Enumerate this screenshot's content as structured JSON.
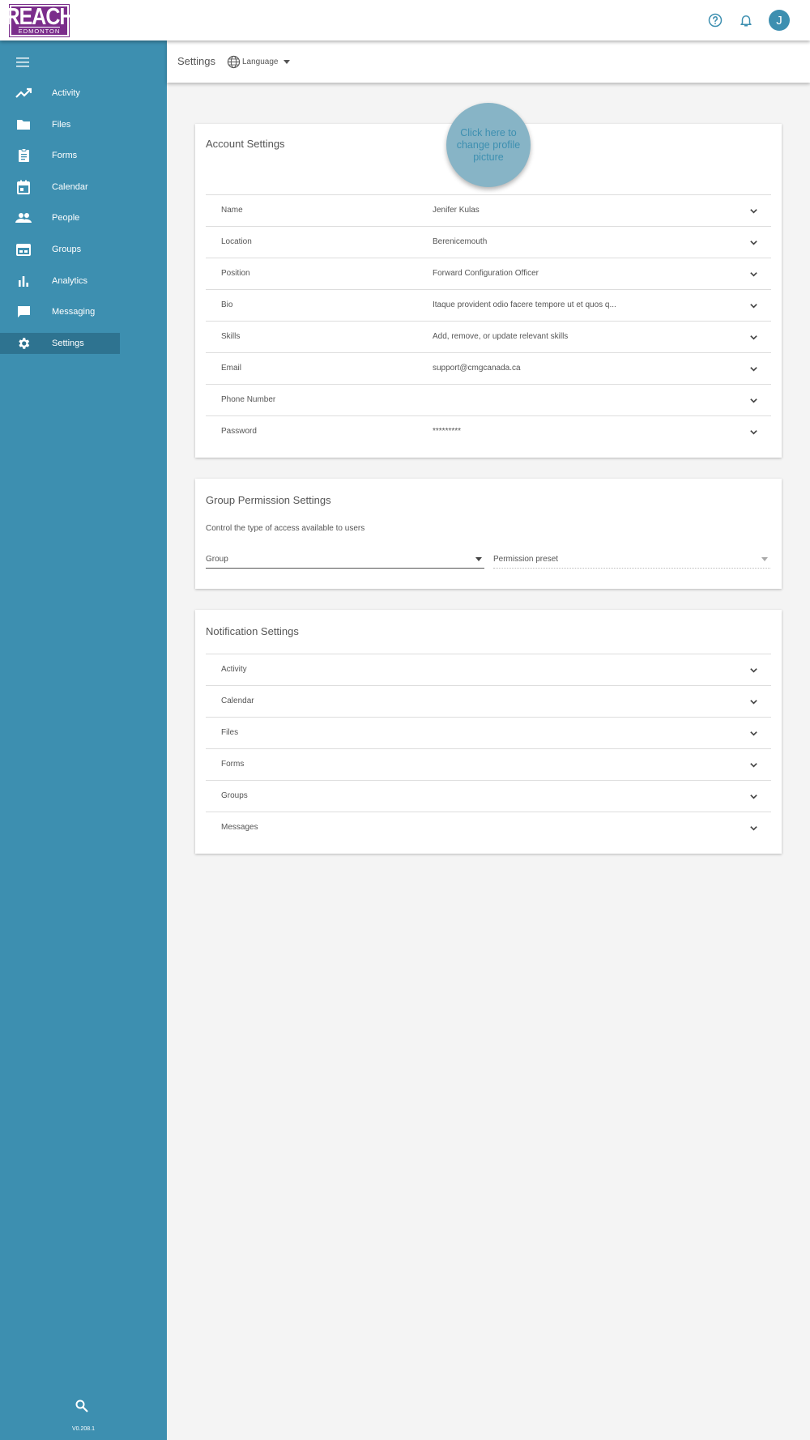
{
  "app": {
    "logo_line1": "REACH",
    "logo_line2": "EDMONTON",
    "avatar_initial": "J",
    "accent": "#3d8fb0",
    "brand": "#7b2d8b"
  },
  "sidebar": {
    "items": [
      {
        "label": "Activity",
        "icon": "activity-icon"
      },
      {
        "label": "Files",
        "icon": "folder-icon"
      },
      {
        "label": "Forms",
        "icon": "clipboard-icon"
      },
      {
        "label": "Calendar",
        "icon": "calendar-icon"
      },
      {
        "label": "People",
        "icon": "people-icon"
      },
      {
        "label": "Groups",
        "icon": "groups-icon"
      },
      {
        "label": "Analytics",
        "icon": "bar-chart-icon"
      },
      {
        "label": "Messaging",
        "icon": "chat-icon"
      },
      {
        "label": "Settings",
        "icon": "gear-icon"
      }
    ],
    "active": "Settings",
    "version": "V0.208.1"
  },
  "header": {
    "title": "Settings",
    "language_label": "Language"
  },
  "account": {
    "title": "Account Settings",
    "profile_pic_text": "Click here to change profile picture",
    "rows": [
      {
        "label": "Name",
        "value": "Jenifer Kulas"
      },
      {
        "label": "Location",
        "value": "Berenicemouth"
      },
      {
        "label": "Position",
        "value": "Forward Configuration Officer"
      },
      {
        "label": "Bio",
        "value": "Itaque provident odio facere tempore ut et quos q..."
      },
      {
        "label": "Skills",
        "value": "Add, remove, or update relevant skills"
      },
      {
        "label": "Email",
        "value": "support@cmgcanada.ca"
      },
      {
        "label": "Phone Number",
        "value": ""
      },
      {
        "label": "Password",
        "value": "*********"
      }
    ]
  },
  "group_permissions": {
    "title": "Group Permission Settings",
    "description": "Control the type of access available to users",
    "group_label": "Group",
    "preset_label": "Permission preset"
  },
  "notifications": {
    "title": "Notification Settings",
    "rows": [
      {
        "label": "Activity"
      },
      {
        "label": "Calendar"
      },
      {
        "label": "Files"
      },
      {
        "label": "Forms"
      },
      {
        "label": "Groups"
      },
      {
        "label": "Messages"
      }
    ]
  }
}
